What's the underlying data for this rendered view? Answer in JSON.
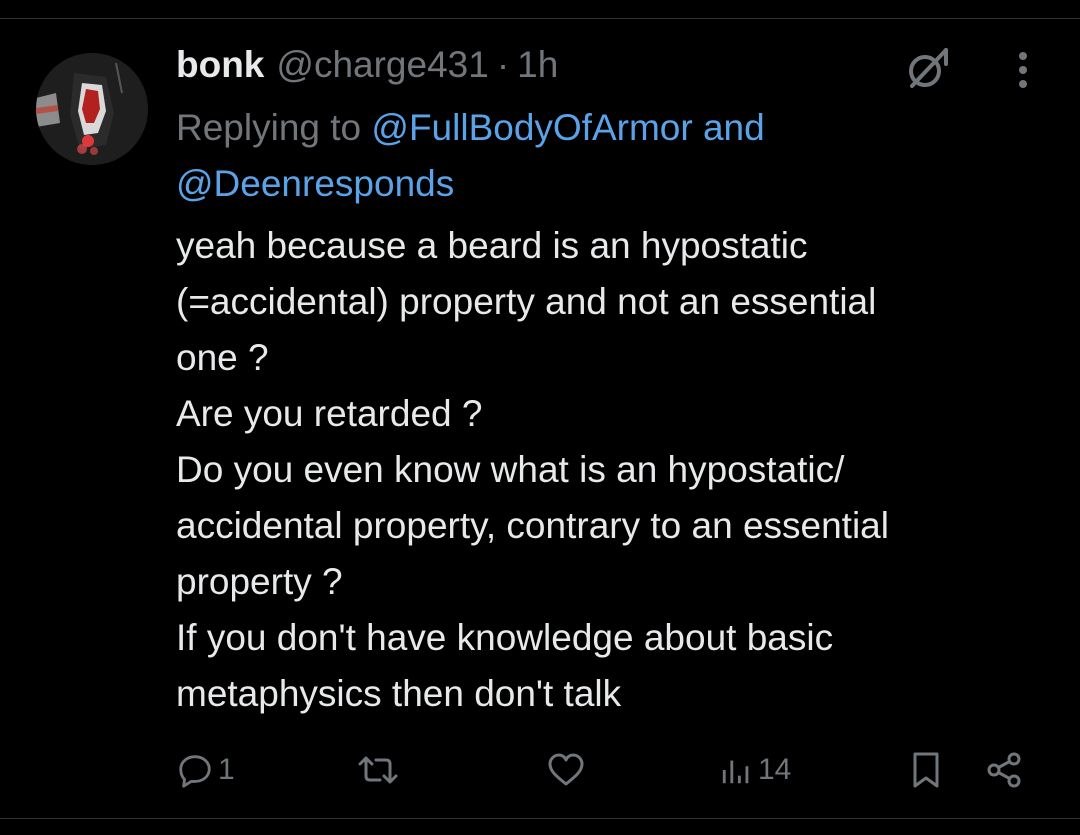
{
  "tweet": {
    "display_name": "bonk",
    "handle": "@charge431",
    "separator": "·",
    "time": "1h",
    "reply_prefix": "Replying to",
    "reply_mention_1": "@FullBodyOfArmor",
    "reply_and": "and",
    "reply_mention_2": "@Deenresponds",
    "body_lines": [
      "yeah because a beard is an hypostatic",
      "(=accidental) property and not an essential",
      "one ?",
      "Are you retarded ?",
      "Do you even know what is an hypostatic/",
      "accidental property, contrary to an essential",
      "property ?",
      "If you don't have knowledge about basic",
      "metaphysics then don't talk"
    ]
  },
  "actions": {
    "reply_count": "1",
    "retweet_count": "",
    "like_count": "",
    "views_count": "14"
  },
  "icons": {
    "grok": "grok-icon",
    "more": "more-dots-icon",
    "reply": "reply-bubble-icon",
    "retweet": "retweet-icon",
    "like": "heart-icon",
    "views": "views-bar-icon",
    "bookmark": "bookmark-icon",
    "share": "share-icon"
  },
  "colors": {
    "background": "#000000",
    "text": "#e7e9ea",
    "muted": "#71767b",
    "link": "#5aa3e8"
  }
}
